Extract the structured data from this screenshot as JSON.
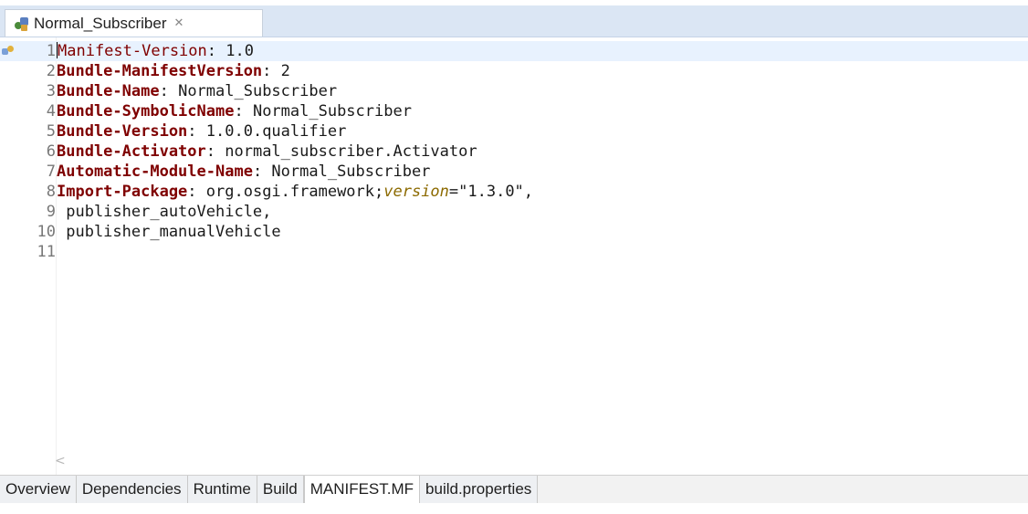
{
  "editor_tab": {
    "title": "Normal_Subscriber",
    "close_glyph": "✕",
    "icon": "plugin-manifest-icon"
  },
  "lines": [
    {
      "num": "1",
      "key": "Manifest-Version",
      "sep": ": ",
      "value": "1.0"
    },
    {
      "num": "2",
      "key": "Bundle-ManifestVersion",
      "sep": ": ",
      "value": "2"
    },
    {
      "num": "3",
      "key": "Bundle-Name",
      "sep": ": ",
      "value": "Normal_Subscriber"
    },
    {
      "num": "4",
      "key": "Bundle-SymbolicName",
      "sep": ": ",
      "value": "Normal_Subscriber"
    },
    {
      "num": "5",
      "key": "Bundle-Version",
      "sep": ": ",
      "value": "1.0.0.qualifier"
    },
    {
      "num": "6",
      "key": "Bundle-Activator",
      "sep": ": ",
      "value": "normal_subscriber.Activator"
    },
    {
      "num": "7",
      "key": "Automatic-Module-Name",
      "sep": ": ",
      "value": "Normal_Subscriber"
    },
    {
      "num": "8",
      "key": "Import-Package",
      "sep": ": ",
      "value": "org.osgi.framework;",
      "attr": "version",
      "attr_value": "=\"1.3.0\","
    },
    {
      "num": "9",
      "value": " publisher_autoVehicle,"
    },
    {
      "num": "10",
      "value": " publisher_manualVehicle"
    },
    {
      "num": "11",
      "value": ""
    }
  ],
  "scroll_indicator": "<",
  "page_tabs": [
    {
      "label": "Overview",
      "active": false
    },
    {
      "label": "Dependencies",
      "active": false
    },
    {
      "label": "Runtime",
      "active": false
    },
    {
      "label": "Build",
      "active": false
    },
    {
      "label": "MANIFEST.MF",
      "active": true
    },
    {
      "label": "build.properties",
      "active": false
    }
  ],
  "colors": {
    "header_key": "#7f0000",
    "attribute": "#8c6a00",
    "current_line": "#e8f2fe",
    "tab_bar": "#dbe6f4"
  }
}
